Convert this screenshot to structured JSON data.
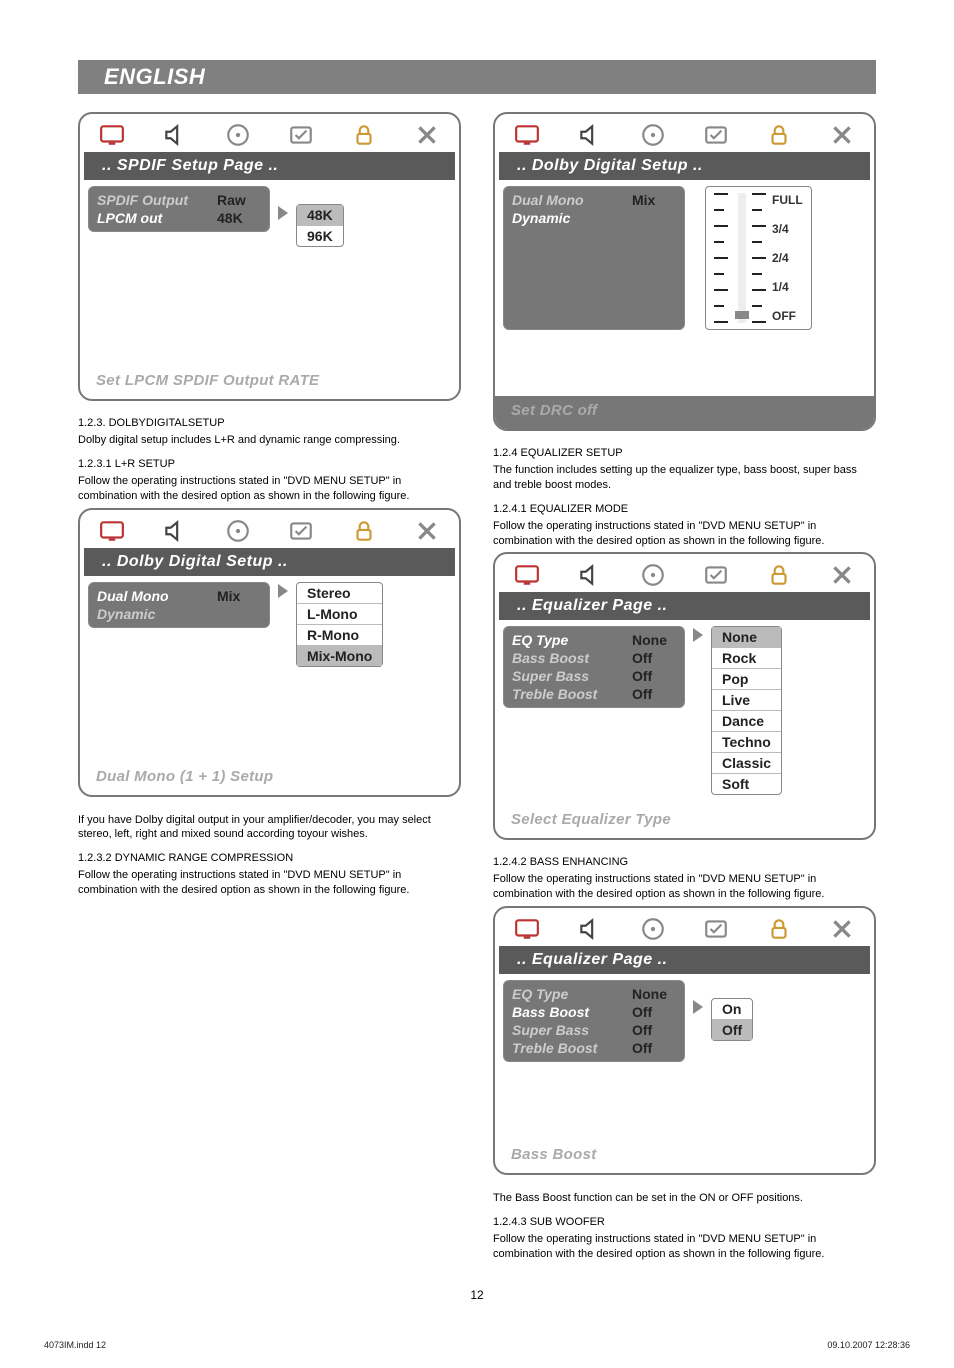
{
  "page": {
    "lang_header": "ENGLISH",
    "page_number": "12",
    "footer_left": "4073IM.indd   12",
    "footer_right": "09.10.2007   12:28:36"
  },
  "left": {
    "panel_spdif": {
      "title": ".. SPDIF Setup Page ..",
      "rows": [
        {
          "label": "SPDIF Output",
          "value": "Raw"
        },
        {
          "label": "LPCM out",
          "value": "48K"
        }
      ],
      "options": [
        "48K",
        "96K"
      ],
      "hint": "Set LPCM SPDIF Output RATE"
    },
    "sec_123": {
      "num": "1.2.3.",
      "title": "DOLBYDIGITALSETUP",
      "body": "Dolby digital setup includes L+R and dynamic range compressing."
    },
    "sec_1231": {
      "num": "1.2.3.1",
      "title": "L+R SETUP",
      "body": "Follow the operating instructions stated in \"DVD MENU SETUP\" in combination with the desired option as shown in the following figure."
    },
    "panel_dolby1": {
      "title": ".. Dolby Digital Setup ..",
      "rows": [
        {
          "label": "Dual Mono",
          "value": "Mix"
        },
        {
          "label": "Dynamic",
          "value": ""
        }
      ],
      "options": [
        "Stereo",
        "L-Mono",
        "R-Mono",
        "Mix-Mono"
      ],
      "hint": "Dual Mono (1 + 1) Setup"
    },
    "para_amp": "If you have Dolby digital output in your amplifier/decoder, you may select stereo, left, right and mixed sound according toyour wishes.",
    "sec_1232": {
      "num": "1.2.3.2",
      "title": "DYNAMIC RANGE COMPRESSION",
      "body": "Follow the operating instructions stated in \"DVD MENU SETUP\" in combination with the desired option as shown in the following figure."
    }
  },
  "right": {
    "panel_dolby2": {
      "title": ".. Dolby Digital Setup ..",
      "rows": [
        {
          "label": "Dual Mono",
          "value": "Mix"
        },
        {
          "label": "Dynamic",
          "value": ""
        }
      ],
      "drc_labels": [
        "FULL",
        "3/4",
        "2/4",
        "1/4",
        "OFF"
      ],
      "hint": "Set DRC off"
    },
    "sec_124": {
      "num": "1.2.4",
      "title": "EQUALIZER SETUP",
      "body": "The function includes setting up the equalizer type, bass boost, super bass and treble boost modes."
    },
    "sec_1241": {
      "num": "1.2.4.1",
      "title": "EQUALIZER MODE",
      "body": "Follow the operating instructions stated in \"DVD MENU SETUP\" in combination with the desired option as shown in the following figure."
    },
    "panel_eq1": {
      "title": ".. Equalizer Page ..",
      "rows": [
        {
          "label": "EQ Type",
          "value": "None"
        },
        {
          "label": "Bass Boost",
          "value": "Off"
        },
        {
          "label": "Super Bass",
          "value": "Off"
        },
        {
          "label": "Treble Boost",
          "value": "Off"
        }
      ],
      "options": [
        "None",
        "Rock",
        "Pop",
        "Live",
        "Dance",
        "Techno",
        "Classic",
        "Soft"
      ],
      "hint": "Select Equalizer Type"
    },
    "sec_1242": {
      "num": "1.2.4.2",
      "title": "BASS ENHANCING",
      "body": "Follow the operating instructions stated in \"DVD MENU SETUP\" in combination with the desired option as shown in the following figure."
    },
    "panel_eq2": {
      "title": ".. Equalizer Page ..",
      "rows": [
        {
          "label": "EQ Type",
          "value": "None"
        },
        {
          "label": "Bass Boost",
          "value": "Off"
        },
        {
          "label": "Super Bass",
          "value": "Off"
        },
        {
          "label": "Treble Boost",
          "value": "Off"
        }
      ],
      "options": [
        "On",
        "Off"
      ],
      "hint": "Bass Boost"
    },
    "para_bass": "The Bass Boost function can be set in the ON or OFF positions.",
    "sec_1243": {
      "num": "1.2.4.3",
      "title": "SUB WOOFER",
      "body": "Follow the operating instructions stated in \"DVD MENU SETUP\" in combination with the desired option as shown in the following figure."
    }
  },
  "icons": {
    "monitor": "monitor-icon",
    "speaker": "speaker-icon",
    "disc": "disc-icon",
    "check": "check-icon",
    "lock": "lock-icon",
    "close": "close-icon"
  }
}
